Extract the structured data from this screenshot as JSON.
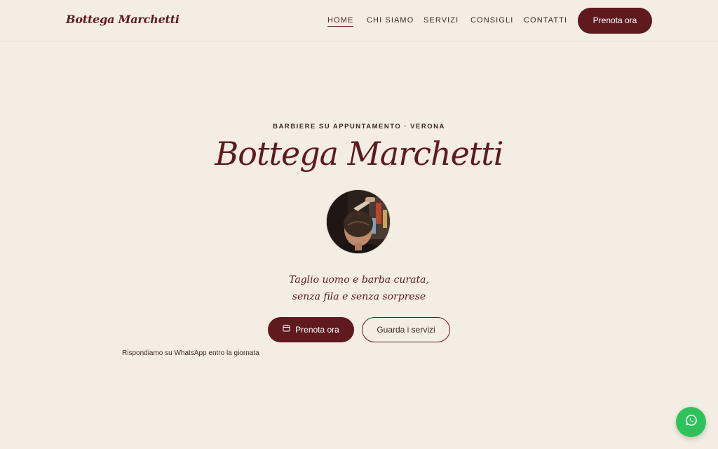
{
  "header": {
    "logo": "Bottega Marchetti",
    "nav": [
      {
        "label": "HOME",
        "active": true
      },
      {
        "label": "CHI SIAMO",
        "active": false
      },
      {
        "label": "SERVIZI",
        "active": false
      },
      {
        "label": "CONSIGLI",
        "active": false
      },
      {
        "label": "CONTATTI",
        "active": false
      }
    ],
    "cta_label": "Prenota ora"
  },
  "hero": {
    "eyebrow": "BARBIERE SU APPUNTAMENTO · VERONA",
    "title": "Bottega Marchetti",
    "tagline_line1": "Taglio uomo e barba curata,",
    "tagline_line2": "senza fila e senza sorprese",
    "primary_button": "Prenota ora",
    "primary_icon": "calendar-icon",
    "secondary_button": "Guarda i servizi",
    "note": "Rispondiamo su WhatsApp entro la giornata"
  },
  "floating": {
    "icon": "whatsapp-icon"
  },
  "colors": {
    "background": "#f3ede3",
    "brand": "#5e1a1f",
    "whatsapp": "#2ec35a"
  }
}
